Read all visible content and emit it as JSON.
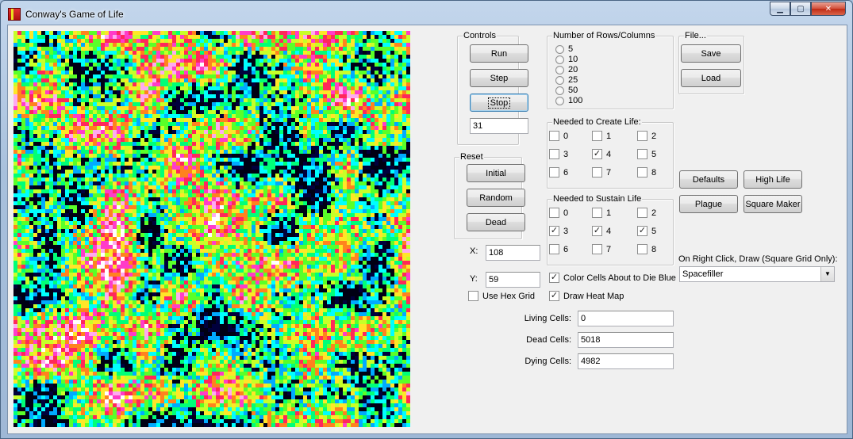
{
  "window": {
    "title": "Conway's Game of Life"
  },
  "grid": {
    "cells_per_side": 100
  },
  "controls": {
    "group_label": "Controls",
    "run": "Run",
    "step": "Step",
    "stop": "Stop",
    "generation_value": "31"
  },
  "rows_columns": {
    "group_label": "Number of Rows/Columns",
    "options": [
      "5",
      "10",
      "20",
      "25",
      "50",
      "100"
    ]
  },
  "file": {
    "group_label": "File...",
    "save": "Save",
    "load": "Load"
  },
  "reset": {
    "group_label": "Reset",
    "initial": "Initial",
    "random": "Random",
    "dead": "Dead"
  },
  "create_life": {
    "group_label": "Needed to Create Life:",
    "options": [
      {
        "label": "0",
        "checked": false
      },
      {
        "label": "1",
        "checked": false
      },
      {
        "label": "2",
        "checked": false
      },
      {
        "label": "3",
        "checked": false
      },
      {
        "label": "4",
        "checked": true
      },
      {
        "label": "5",
        "checked": false
      },
      {
        "label": "6",
        "checked": false
      },
      {
        "label": "7",
        "checked": false
      },
      {
        "label": "8",
        "checked": false
      }
    ]
  },
  "sustain_life": {
    "group_label": "Needed to Sustain Life",
    "options": [
      {
        "label": "0",
        "checked": false
      },
      {
        "label": "1",
        "checked": false
      },
      {
        "label": "2",
        "checked": false
      },
      {
        "label": "3",
        "checked": true
      },
      {
        "label": "4",
        "checked": true
      },
      {
        "label": "5",
        "checked": true
      },
      {
        "label": "6",
        "checked": false
      },
      {
        "label": "7",
        "checked": false
      },
      {
        "label": "8",
        "checked": false
      }
    ]
  },
  "presets": {
    "defaults": "Defaults",
    "high_life": "High Life",
    "plague": "Plague",
    "square_maker": "Square Maker"
  },
  "coords": {
    "x_label": "X:",
    "x_value": "108",
    "y_label": "Y:",
    "y_value": "59"
  },
  "options": {
    "color_dying_label": "Color Cells About to Die Blue",
    "color_dying_checked": true,
    "hex_grid_label": "Use Hex Grid",
    "hex_grid_checked": false,
    "heat_map_label": "Draw Heat Map",
    "heat_map_checked": true
  },
  "right_click": {
    "label": "On Right Click, Draw (Square Grid Only):",
    "selected": "Spacefiller"
  },
  "stats": {
    "living_label": "Living Cells:",
    "living_value": "0",
    "dead_label": "Dead Cells:",
    "dead_value": "5018",
    "dying_label": "Dying Cells:",
    "dying_value": "4982"
  },
  "colors": {
    "heat_low": "#000044",
    "heat_mid": "#00ff80",
    "heat_high": "#ff40c0",
    "hot": "#ffffff"
  }
}
